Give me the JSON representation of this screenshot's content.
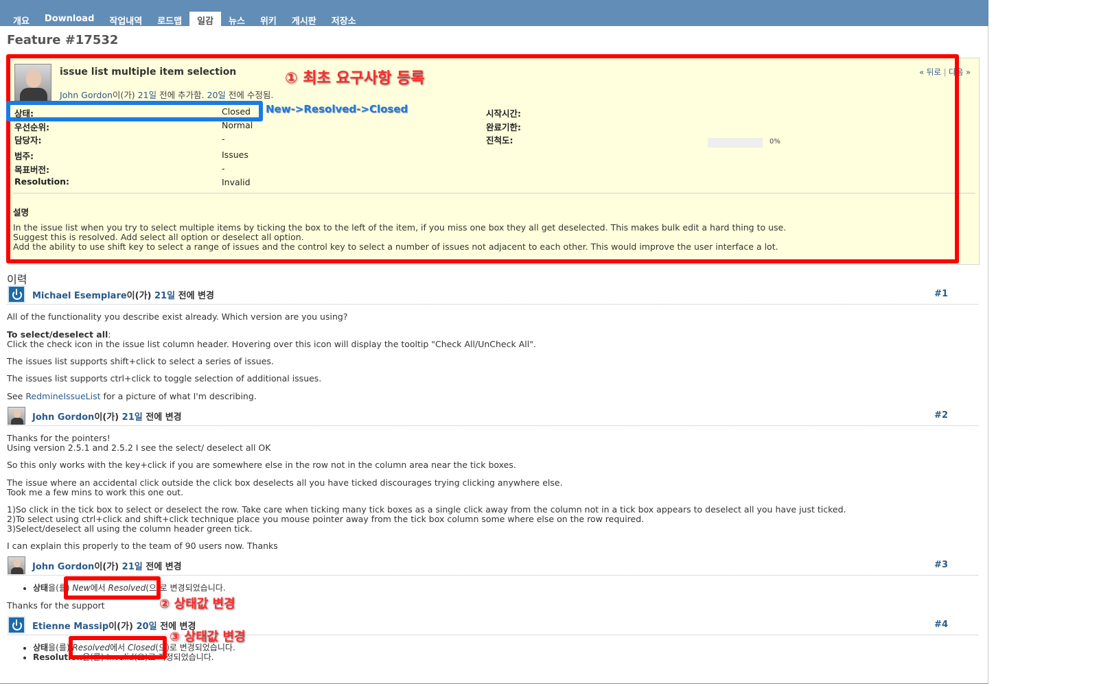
{
  "tabs": [
    "개요",
    "Download",
    "작업내역",
    "로드맵",
    "일감",
    "뉴스",
    "위키",
    "게시판",
    "저장소"
  ],
  "selected_tab": "일감",
  "page_title": "Feature #17532",
  "issue": {
    "subject": "issue list multiple item selection",
    "author": "John Gordon",
    "author_suffix": "이(가)",
    "added_ago": "21일",
    "added_text": "전에 추가함.",
    "updated_ago": "20일",
    "updated_text": "전에 수정됨.",
    "prev": "« 뒤로",
    "next": "다음 »",
    "nav_sep": "|",
    "left_attrs": [
      {
        "label": "상태:",
        "value": "Closed"
      },
      {
        "label": "우선순위:",
        "value": "Normal"
      },
      {
        "label": "담당자:",
        "value": "-"
      },
      {
        "label": "범주:",
        "value": "Issues"
      },
      {
        "label": "목표버전:",
        "value": "-"
      },
      {
        "label": "Resolution:",
        "value": "Invalid"
      }
    ],
    "right_attrs": [
      {
        "label": "시작시간:",
        "value": ""
      },
      {
        "label": "완료기한:",
        "value": ""
      },
      {
        "label": "진척도:",
        "value": ""
      }
    ],
    "progress_percent": 0,
    "progress_label": "0%",
    "description_heading": "설명",
    "description_lines": [
      "In the issue list when you try to select multiple items by ticking the box to the left of the item, if you miss one box they all get deselected. This makes bulk edit a hard thing to use.",
      "Suggest this is resolved. Add select all option or deselect all option.",
      "Add the ability to use shift key to select a range of issues and the control key to select a number of issues not adjacent to each other. This would improve the user interface a lot."
    ]
  },
  "history_heading": "이력",
  "journals": [
    {
      "user": "Michael Esemplare",
      "suffix": "이(가)",
      "ago": "21일",
      "changed": "전에 변경",
      "num": "#1",
      "icon": "redmine-icon"
    },
    {
      "user": "John Gordon",
      "suffix": "이(가)",
      "ago": "21일",
      "changed": "전에 변경",
      "num": "#2",
      "icon": "user-photo-icon"
    },
    {
      "user": "John Gordon",
      "suffix": "이(가)",
      "ago": "21일",
      "changed": "전에 변경",
      "num": "#3",
      "icon": "user-photo-icon"
    },
    {
      "user": "Etienne Massip",
      "suffix": "이(가)",
      "ago": "20일",
      "changed": "전에 변경",
      "num": "#4",
      "icon": "redmine-icon"
    }
  ],
  "j1": {
    "line1": "All of the functionality you describe exist already. Which version are you using?",
    "bold": "To select/deselect all",
    "bold_colon": ":",
    "line2": "Click the check icon in the issue list column header. Hovering over this icon will display the tooltip \"Check All/UnCheck All\".",
    "line3": "The issues list supports shift+click to select a series of issues.",
    "line4": "The issues list supports ctrl+click to toggle selection of additional issues.",
    "line5_pre": "See",
    "line5_link": "RedmineIssueList",
    "line5_post": "for a picture of what I'm describing."
  },
  "j2": {
    "line1": "Thanks for the pointers!",
    "line2": "Using version 2.5.1 and 2.5.2 I see the select/ deselect all OK",
    "line3": "So this only works with the key+click if you are somewhere else in the row not in the column area near the tick boxes.",
    "line4": "The issue where an accidental click outside the click box deselects all you have ticked discourages trying clicking anywhere else.",
    "line5": "Took me a few mins to work this one out.",
    "line6": "1)So click in the tick box to select or deselect the row. Take care when ticking many tick boxes as a single click away from the column not in a tick box appears to deselect all you have just ticked.",
    "line7": "2)To select using ctrl+click and shift+click technique place you mouse pointer away from the tick box column some where else on the row required.",
    "line8": "3)Select/deselect all using the column header green tick.",
    "line9": "I can explain this properly to the team of 90 users now. Thanks"
  },
  "j3": {
    "detail_label": "상태",
    "detail_pre": "을(를)",
    "old": "New",
    "mid": "에서",
    "new": "Resolved",
    "post": "(으)로 변경되었습니다.",
    "note": "Thanks for the support"
  },
  "j4": {
    "d1_label": "상태",
    "d1_pre": "을(를)",
    "d1_old": "Resolved",
    "d1_mid": "에서",
    "d1_new": "Closed",
    "d1_post": "(으)로 변경되었습니다.",
    "d2_label": "Resolution",
    "d2_text": "을(를) Invalid(으)로 지정되었습니다."
  },
  "annotations": {
    "a1": "① 최초 요구사항 등록",
    "a_blue": "New->Resolved->Closed",
    "a2": "② 상태값 변경",
    "a3": "③ 상태값 변경",
    "red_color": "#ff0000",
    "blue_color": "#1a7be6"
  },
  "colors": {
    "header": "#628db6",
    "issue_bg": "#ffffdd",
    "link": "#2a5a8a"
  }
}
